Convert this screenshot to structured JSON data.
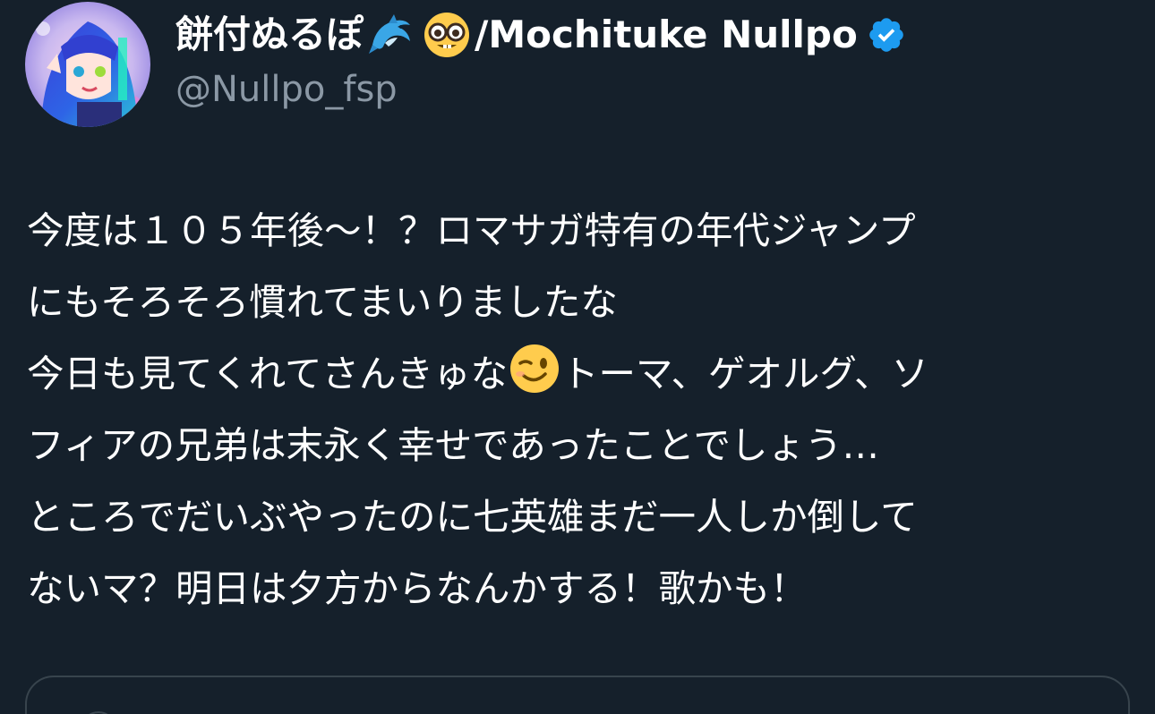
{
  "author": {
    "display_name_jp": "餅付ぬるぽ",
    "display_name_en": "/Mochituke Nullpo",
    "handle": "@Nullpo_fsp",
    "name_emojis": [
      "dolphin-emoji",
      "nerd-face-emoji"
    ],
    "verified": true,
    "verified_color": "#1d9bf0"
  },
  "tweet": {
    "lines": [
      {
        "before": "今度は１０５年後〜！？ロマサガ特有の年代ジャンプ"
      },
      {
        "before": "にもそろそろ慣れてまいりましたな"
      },
      {
        "before": "今日も見てくれてさんきゅな",
        "emoji": "winking-face-emoji",
        "after": "トーマ、ゲオルグ、ソ"
      },
      {
        "before": "フィアの兄弟は末永く幸せであったことでしょう…"
      },
      {
        "before": "ところでだいぶやったのに七英雄まだ一人しか倒して"
      },
      {
        "before": "ないマ？明日は夕方からなんかする！歌かも！"
      }
    ]
  },
  "colors": {
    "background": "#15202b",
    "text": "#ffffff",
    "secondary_text": "#8b98a5",
    "border": "#38444d"
  }
}
